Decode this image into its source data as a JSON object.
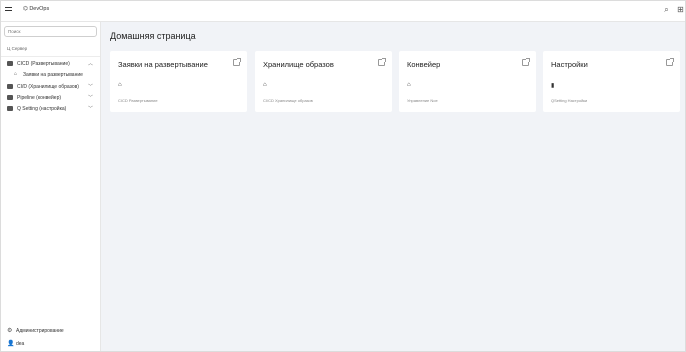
{
  "topbar": {
    "brand": "⌬ DevOps",
    "icons": [
      "search-icon",
      "grid-icon"
    ]
  },
  "sidebar": {
    "search_placeholder": "Поиск",
    "section_title": "Ц Сервер",
    "items": [
      {
        "label": "CICD (Развертывание)",
        "icon": "book-icon",
        "expanded": true
      },
      {
        "label": "Заявки на развертывание",
        "icon": "home-icon"
      },
      {
        "label": "CI/D (Хранилище образов)",
        "icon": "book-icon",
        "expanded": false
      },
      {
        "label": "Pipeline (конвейер)",
        "icon": "book-icon",
        "expanded": false
      },
      {
        "label": "Q Setting (настройка)",
        "icon": "book-icon",
        "expanded": false
      }
    ],
    "bottom": [
      {
        "label": "Администрирование",
        "icon": "gear-icon"
      },
      {
        "label": "dea",
        "icon": "user-icon"
      }
    ]
  },
  "main": {
    "title": "Домашняя страница",
    "cards": [
      {
        "title": "Заявки на развертывание",
        "desc": "CICD Развертывание"
      },
      {
        "title": "Хранилище образов",
        "desc": "CI/CD Хранилище образов"
      },
      {
        "title": "Конвейер",
        "desc": "Управление Noe"
      },
      {
        "title": "Настройки",
        "desc": "QSetting Настройки"
      }
    ]
  }
}
